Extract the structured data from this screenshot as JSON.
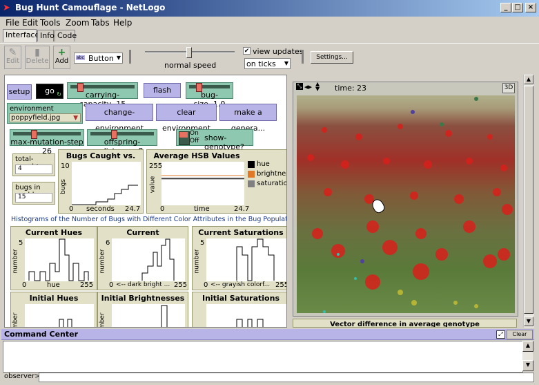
{
  "window": {
    "title": "Bug Hunt Camouflage - NetLogo"
  },
  "menu": [
    "File",
    "Edit",
    "Tools",
    "Zoom",
    "Tabs",
    "Help"
  ],
  "tabs": [
    "Interface",
    "Info",
    "Code"
  ],
  "toolbar": {
    "edit": "Edit",
    "delete": "Delete",
    "add": "Add",
    "widget_type": "Button",
    "speed_label": "normal speed",
    "view_updates_label": "view updates",
    "update_mode": "on ticks",
    "settings": "Settings..."
  },
  "widgets": {
    "setup": "setup",
    "go": "go",
    "carrying_capacity": {
      "label": "carrying-capacity",
      "value": "15",
      "fraction": 0.12
    },
    "flash": "flash",
    "bug_size": {
      "label": "bug-size",
      "value": "1.0",
      "fraction": 0.15
    },
    "environment": {
      "label": "environment",
      "value": "poppyfield.jpg"
    },
    "change_environment": "change-environment",
    "clear_environment": "clear environment",
    "make_generation": "make a genera...",
    "max_mutation_step": {
      "label": "max-mutation-step",
      "value": "26",
      "fraction": 0.3
    },
    "offspring_distance": {
      "label": "offspring-distance",
      "value": "8",
      "fraction": 0.35
    },
    "show_genotype": {
      "on": "On",
      "off": "Off",
      "label": "show-genotype?"
    },
    "total_caught": {
      "label": "total-caught",
      "value": "4"
    },
    "bugs_in_world": {
      "label": "bugs in world",
      "value": "15"
    }
  },
  "plots": {
    "bugs_caught": {
      "title": "Bugs Caught vs. Ti...",
      "ylabel": "bugs",
      "xlabel": "seconds",
      "ymax": "10",
      "xmin": "0",
      "xmax": "24.7"
    },
    "hsb": {
      "title": "Average HSB Values",
      "ylabel": "value",
      "xlabel": "time",
      "ymax": "255",
      "xmin": "0",
      "xmax": "24.7",
      "legend": [
        {
          "name": "hue",
          "color": "#000000"
        },
        {
          "name": "brightness",
          "color": "#e07828"
        },
        {
          "name": "saturation",
          "color": "#808080"
        }
      ]
    },
    "histogram_caption": "Histograms of the Number of Bugs with Different Color Attributes in the Bug Population:",
    "current_hues": {
      "title": "Current Hues",
      "ylabel": "number",
      "ymax": "5",
      "xmin": "0",
      "xlabel": "hue",
      "xmax": "255"
    },
    "current_brightnesses": {
      "title": "Current Brightnesses",
      "ylabel": "number",
      "ymax": "6",
      "xmin": "0",
      "xlabel": "<-- dark   bright ...",
      "xmax": "255"
    },
    "current_saturations": {
      "title": "Current Saturations",
      "ylabel": "number",
      "ymax": "5",
      "xmin": "0",
      "xlabel": "<-- grayish   colorf...",
      "xmax": "255"
    },
    "initial_hues": {
      "title": "Initial Hues",
      "ylabel": "number"
    },
    "initial_brightnesses": {
      "title": "Initial Brightnesses",
      "ylabel": "number"
    },
    "initial_saturations": {
      "title": "Initial Saturations",
      "ylabel": "number"
    }
  },
  "view": {
    "time_label": "time: 23",
    "threed": "3D"
  },
  "vector_label": "Vector difference in average genotype",
  "command_center": {
    "title": "Command Center",
    "clear": "Clear",
    "prompt": "observer>"
  }
}
